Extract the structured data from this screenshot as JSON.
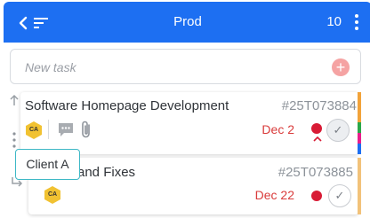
{
  "header": {
    "title": "Prod",
    "count": "10",
    "back_icon": "back-icon",
    "sort_icon": "sort-icon",
    "menu_icon": "kebab-menu-icon",
    "color": "#1d6ff2"
  },
  "new_task": {
    "placeholder": "New task",
    "value": "",
    "add_icon": "add-icon"
  },
  "tasks": [
    {
      "name": "Software Homepage Development",
      "id": "#25T073884",
      "client_initials": "CA",
      "due": "Dec 2",
      "priority_color": "#d81b35",
      "icons": [
        "comment-icon",
        "attachment-icon",
        "chevron-up-icon",
        "check-icon"
      ],
      "stripe_colors": [
        "#f2a33a",
        "#2aa84a",
        "#e91e8c",
        "#1d6ff2"
      ]
    },
    {
      "name": "and Fixes",
      "id": "#25T073885",
      "client_initials": "CA",
      "due": "Dec 22",
      "priority_color": "#d81b35",
      "icons": [
        "check-icon"
      ],
      "stripe_colors": [
        "#f2c27a"
      ]
    }
  ],
  "tooltip": {
    "text": "Client A"
  }
}
